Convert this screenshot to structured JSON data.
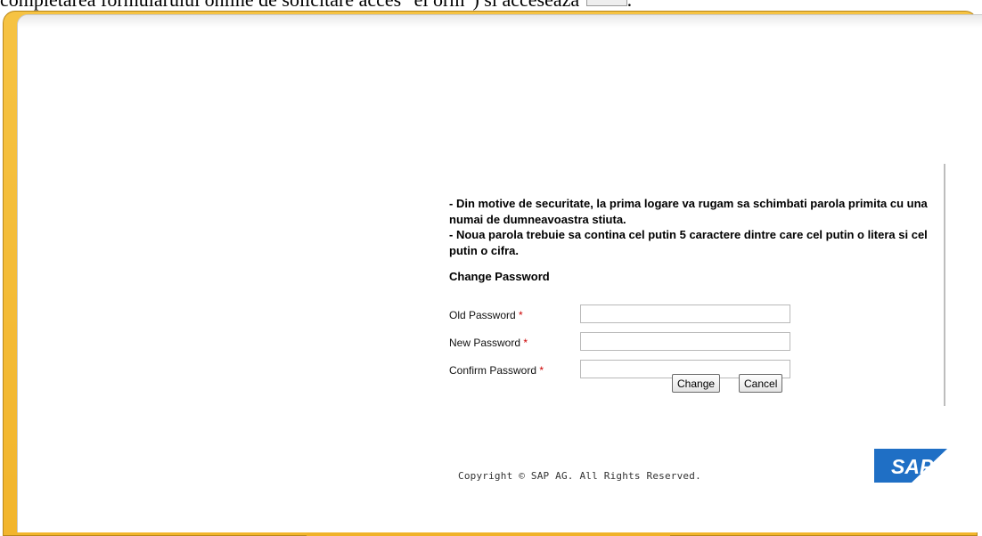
{
  "document": {
    "top_text": "completarea formularului online de solicitare acces \"el orm\") si acceseaza"
  },
  "info": {
    "line1": "- Din motive de securitate, la prima logare va rugam sa schimbati parola primita cu una numai de dumneavoastra stiuta.",
    "line2": "- Noua parola trebuie sa contina cel putin 5 caractere dintre care cel putin o litera si cel putin o cifra."
  },
  "form": {
    "title": "Change Password",
    "required_marker": "*",
    "fields": [
      {
        "label": "Old Password",
        "value": ""
      },
      {
        "label": "New Password",
        "value": ""
      },
      {
        "label": "Confirm Password",
        "value": ""
      }
    ],
    "buttons": {
      "change": "Change",
      "cancel": "Cancel"
    }
  },
  "footer": {
    "copyright": "Copyright © SAP AG. All Rights Reserved.",
    "logo_text": "SAP"
  },
  "colors": {
    "frame": "#f2b52c",
    "required": "#cc0000",
    "logo": "#1f6fc5"
  }
}
